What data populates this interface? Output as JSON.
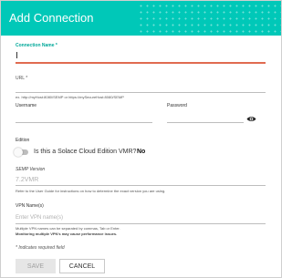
{
  "dialog": {
    "title": "Add Connection",
    "header_color": "#00c8b8"
  },
  "form": {
    "connection_name": {
      "label": "Connection Name *",
      "value": ""
    },
    "url": {
      "label": "URL *",
      "value": "",
      "hint": "ex. http://myHost:8080/SEMP or https://mySecureHost:8080/SEMP"
    },
    "username": {
      "label": "Username",
      "value": ""
    },
    "password": {
      "label": "Password",
      "value": "",
      "icon": "eye-icon"
    },
    "edition": {
      "label": "Edition",
      "question": "Is this a Solace Cloud Edition VMR?",
      "answer": "No",
      "toggle_on": false
    },
    "semp_version": {
      "label": "SEMP Version",
      "placeholder": "7.2VMR",
      "hint": "Refer to the User Guide for instructions on how to determine the exact version you are using."
    },
    "vpn_names": {
      "label": "VPN Name(s)",
      "placeholder": "Enter VPN name(s)",
      "hint_line1": "Multiple VPN names can be separated by commas, Tab or Enter.",
      "hint_line2": "Monitoring multiple VPN's may cause performance issues."
    },
    "required_note": "* Indicates required field"
  },
  "buttons": {
    "save": "SAVE",
    "cancel": "CANCEL"
  },
  "colors": {
    "accent": "#00a899",
    "active_underline": "#e06b50"
  }
}
